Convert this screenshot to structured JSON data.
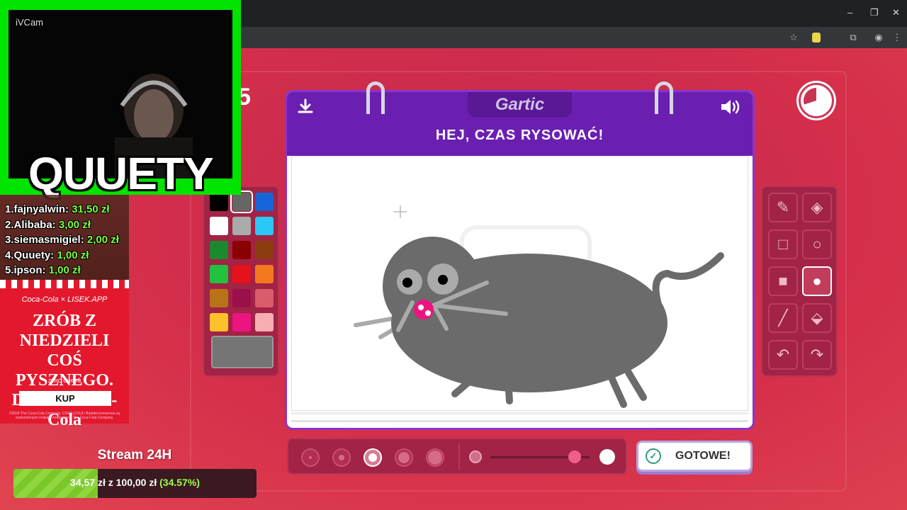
{
  "browser": {
    "window_buttons": [
      "–",
      "❐",
      "✕"
    ],
    "toolbar_icons": [
      "star-icon",
      "extension-icon",
      "puzzle-icon",
      "profile-icon",
      "menu-icon"
    ]
  },
  "webcam": {
    "label": "iVCam",
    "overlay_text": "QUUETY"
  },
  "donors": [
    {
      "rank": "1.",
      "name": "fajnyalwin:",
      "amount": "31,50 zł"
    },
    {
      "rank": "2.",
      "name": "Alibaba:",
      "amount": "3,00 zł"
    },
    {
      "rank": "3.",
      "name": "siemasmigiel:",
      "amount": "2,00 zł"
    },
    {
      "rank": "4.",
      "name": "Quuety:",
      "amount": "1,00 zł"
    },
    {
      "rank": "5.",
      "name": "ipson:",
      "amount": "1,00 zł"
    }
  ],
  "ad": {
    "brand": "Coca-Cola × LISEK.APP",
    "line1": "ZRÓB Z NIEDZIELI",
    "line2": "COŚ PYSZNEGO.",
    "line3": "DODAJ Coca-Cola",
    "sub": "ZERO CUKRU",
    "button": "KUP",
    "legal": "©2024 The Coca-Cola Company. COCA-COLA i Butelka konturowa są zastrzeżonymi znakami towarowymi The Coca-Cola Company."
  },
  "goal": {
    "title": "Stream 24H",
    "current": "34,57 zł",
    "separator": "z",
    "target": "100,00 zł",
    "percent_text": "(34.57%)",
    "progress": 0.3457
  },
  "game": {
    "round_number": "5",
    "logo": "Gartic",
    "headline": "HEJ, CZAS RYSOWAĆ!",
    "timer_remaining_fraction": 0.7,
    "palette": [
      "#000000",
      "#666666",
      "#1565d8",
      "#ffffff",
      "#aaaaaa",
      "#2ac8f5",
      "#1b8a2e",
      "#8b0000",
      "#8b3d10",
      "#22c13e",
      "#e5121b",
      "#f4781e",
      "#b8721a",
      "#9b0f4a",
      "#d85c6a",
      "#fdc12a",
      "#ec1481",
      "#f7aeb0"
    ],
    "selected_color": "#757575",
    "tools": [
      "pencil-icon",
      "eraser-icon",
      "rectangle-outline-icon",
      "circle-outline-icon",
      "rectangle-fill-icon",
      "circle-fill-icon",
      "line-icon",
      "bucket-icon",
      "undo-icon",
      "redo-icon"
    ],
    "selected_tool": "circle-fill-icon",
    "brush_sizes": 5,
    "selected_size": 3,
    "opacity_level": 0.85,
    "done_button": "GOTOWE!"
  }
}
